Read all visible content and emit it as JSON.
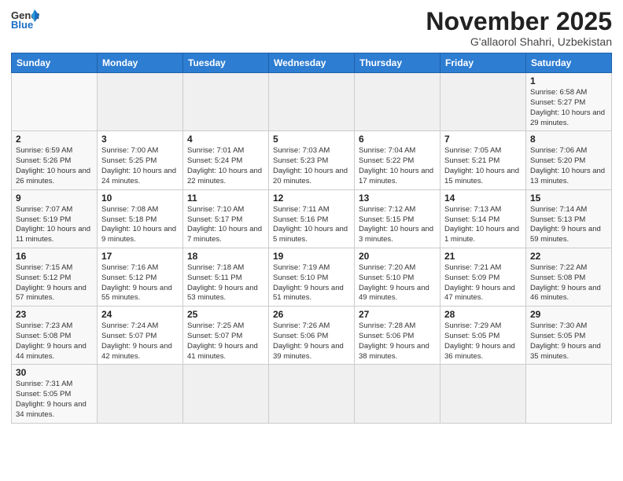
{
  "header": {
    "logo_general": "General",
    "logo_blue": "Blue",
    "month_title": "November 2025",
    "location": "G'allaorol Shahri, Uzbekistan"
  },
  "days_of_week": [
    "Sunday",
    "Monday",
    "Tuesday",
    "Wednesday",
    "Thursday",
    "Friday",
    "Saturday"
  ],
  "weeks": [
    [
      {
        "day": "",
        "info": ""
      },
      {
        "day": "",
        "info": ""
      },
      {
        "day": "",
        "info": ""
      },
      {
        "day": "",
        "info": ""
      },
      {
        "day": "",
        "info": ""
      },
      {
        "day": "",
        "info": ""
      },
      {
        "day": "1",
        "info": "Sunrise: 6:58 AM\nSunset: 5:27 PM\nDaylight: 10 hours and 29 minutes."
      }
    ],
    [
      {
        "day": "2",
        "info": "Sunrise: 6:59 AM\nSunset: 5:26 PM\nDaylight: 10 hours and 26 minutes."
      },
      {
        "day": "3",
        "info": "Sunrise: 7:00 AM\nSunset: 5:25 PM\nDaylight: 10 hours and 24 minutes."
      },
      {
        "day": "4",
        "info": "Sunrise: 7:01 AM\nSunset: 5:24 PM\nDaylight: 10 hours and 22 minutes."
      },
      {
        "day": "5",
        "info": "Sunrise: 7:03 AM\nSunset: 5:23 PM\nDaylight: 10 hours and 20 minutes."
      },
      {
        "day": "6",
        "info": "Sunrise: 7:04 AM\nSunset: 5:22 PM\nDaylight: 10 hours and 17 minutes."
      },
      {
        "day": "7",
        "info": "Sunrise: 7:05 AM\nSunset: 5:21 PM\nDaylight: 10 hours and 15 minutes."
      },
      {
        "day": "8",
        "info": "Sunrise: 7:06 AM\nSunset: 5:20 PM\nDaylight: 10 hours and 13 minutes."
      }
    ],
    [
      {
        "day": "9",
        "info": "Sunrise: 7:07 AM\nSunset: 5:19 PM\nDaylight: 10 hours and 11 minutes."
      },
      {
        "day": "10",
        "info": "Sunrise: 7:08 AM\nSunset: 5:18 PM\nDaylight: 10 hours and 9 minutes."
      },
      {
        "day": "11",
        "info": "Sunrise: 7:10 AM\nSunset: 5:17 PM\nDaylight: 10 hours and 7 minutes."
      },
      {
        "day": "12",
        "info": "Sunrise: 7:11 AM\nSunset: 5:16 PM\nDaylight: 10 hours and 5 minutes."
      },
      {
        "day": "13",
        "info": "Sunrise: 7:12 AM\nSunset: 5:15 PM\nDaylight: 10 hours and 3 minutes."
      },
      {
        "day": "14",
        "info": "Sunrise: 7:13 AM\nSunset: 5:14 PM\nDaylight: 10 hours and 1 minute."
      },
      {
        "day": "15",
        "info": "Sunrise: 7:14 AM\nSunset: 5:13 PM\nDaylight: 9 hours and 59 minutes."
      }
    ],
    [
      {
        "day": "16",
        "info": "Sunrise: 7:15 AM\nSunset: 5:12 PM\nDaylight: 9 hours and 57 minutes."
      },
      {
        "day": "17",
        "info": "Sunrise: 7:16 AM\nSunset: 5:12 PM\nDaylight: 9 hours and 55 minutes."
      },
      {
        "day": "18",
        "info": "Sunrise: 7:18 AM\nSunset: 5:11 PM\nDaylight: 9 hours and 53 minutes."
      },
      {
        "day": "19",
        "info": "Sunrise: 7:19 AM\nSunset: 5:10 PM\nDaylight: 9 hours and 51 minutes."
      },
      {
        "day": "20",
        "info": "Sunrise: 7:20 AM\nSunset: 5:10 PM\nDaylight: 9 hours and 49 minutes."
      },
      {
        "day": "21",
        "info": "Sunrise: 7:21 AM\nSunset: 5:09 PM\nDaylight: 9 hours and 47 minutes."
      },
      {
        "day": "22",
        "info": "Sunrise: 7:22 AM\nSunset: 5:08 PM\nDaylight: 9 hours and 46 minutes."
      }
    ],
    [
      {
        "day": "23",
        "info": "Sunrise: 7:23 AM\nSunset: 5:08 PM\nDaylight: 9 hours and 44 minutes."
      },
      {
        "day": "24",
        "info": "Sunrise: 7:24 AM\nSunset: 5:07 PM\nDaylight: 9 hours and 42 minutes."
      },
      {
        "day": "25",
        "info": "Sunrise: 7:25 AM\nSunset: 5:07 PM\nDaylight: 9 hours and 41 minutes."
      },
      {
        "day": "26",
        "info": "Sunrise: 7:26 AM\nSunset: 5:06 PM\nDaylight: 9 hours and 39 minutes."
      },
      {
        "day": "27",
        "info": "Sunrise: 7:28 AM\nSunset: 5:06 PM\nDaylight: 9 hours and 38 minutes."
      },
      {
        "day": "28",
        "info": "Sunrise: 7:29 AM\nSunset: 5:05 PM\nDaylight: 9 hours and 36 minutes."
      },
      {
        "day": "29",
        "info": "Sunrise: 7:30 AM\nSunset: 5:05 PM\nDaylight: 9 hours and 35 minutes."
      }
    ],
    [
      {
        "day": "30",
        "info": "Sunrise: 7:31 AM\nSunset: 5:05 PM\nDaylight: 9 hours and 34 minutes."
      },
      {
        "day": "",
        "info": ""
      },
      {
        "day": "",
        "info": ""
      },
      {
        "day": "",
        "info": ""
      },
      {
        "day": "",
        "info": ""
      },
      {
        "day": "",
        "info": ""
      },
      {
        "day": "",
        "info": ""
      }
    ]
  ]
}
